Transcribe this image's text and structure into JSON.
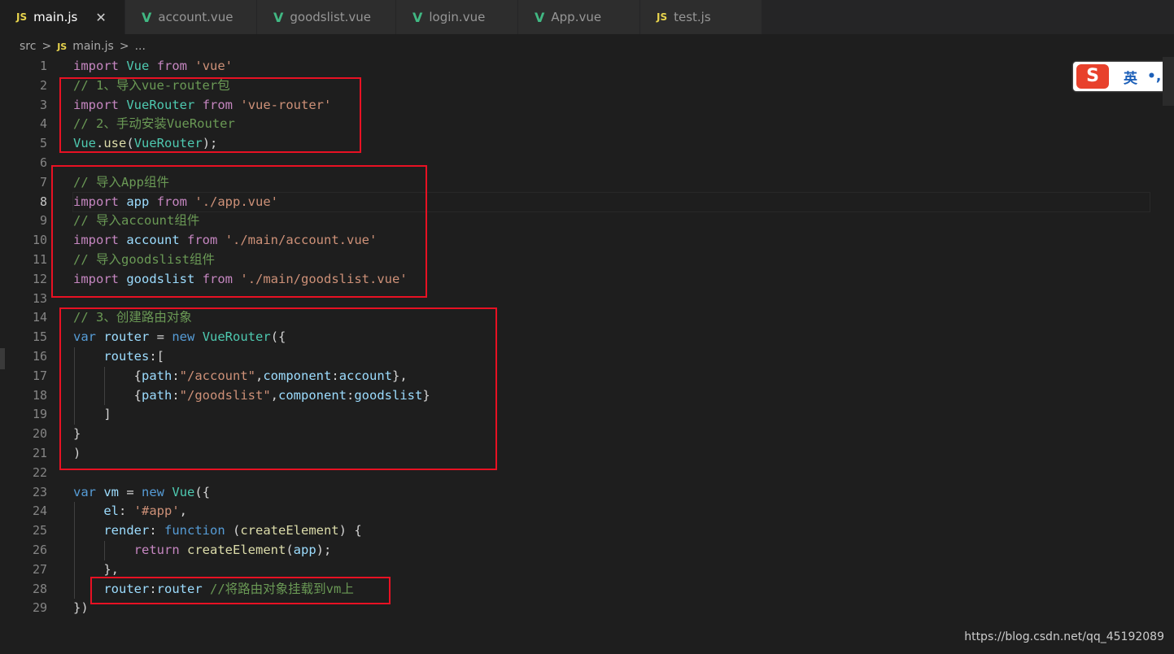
{
  "tabs": [
    {
      "label": "main.js",
      "icon": "JS",
      "type": "js",
      "active": true
    },
    {
      "label": "account.vue",
      "icon": "V",
      "type": "vue"
    },
    {
      "label": "goodslist.vue",
      "icon": "V",
      "type": "vue"
    },
    {
      "label": "login.vue",
      "icon": "V",
      "type": "vue"
    },
    {
      "label": "App.vue",
      "icon": "V",
      "type": "vue"
    },
    {
      "label": "test.js",
      "icon": "JS",
      "type": "js"
    }
  ],
  "close_glyph": "✕",
  "breadcrumb": {
    "folder": "src",
    "sep": ">",
    "file_icon": "JS",
    "file": "main.js",
    "more": "..."
  },
  "current_line": 8,
  "code_lines": [
    "import Vue from 'vue'",
    "// 1、导入vue-router包",
    "import VueRouter from 'vue-router'",
    "// 2、手动安装VueRouter",
    "Vue.use(VueRouter);",
    "",
    "// 导入App组件",
    "import app from './app.vue'",
    "// 导入account组件",
    "import account from './main/account.vue'",
    "// 导入goodslist组件",
    "import goodslist from './main/goodslist.vue'",
    "",
    "// 3、创建路由对象",
    "var router = new VueRouter({",
    "    routes:[",
    "        {path:\"/account\",component:account},",
    "        {path:\"/goodslist\",component:goodslist}",
    "    ]",
    "}",
    ")",
    "",
    "var vm = new Vue({",
    "    el: '#app',",
    "    render: function (createElement) {",
    "        return createElement(app);",
    "    },",
    "    router:router //将路由对象挂载到vm上",
    "})"
  ],
  "ime": {
    "logo": "S",
    "mode": "英",
    "punct": "•,"
  },
  "watermark": "https://blog.csdn.net/qq_45192089",
  "colors": {
    "keyword": "#c586c0",
    "string": "#ce9178",
    "comment": "#6a9955",
    "type": "#4ec9b0",
    "variable": "#9cdcfe",
    "function": "#dcdcaa",
    "storage": "#569cd6",
    "highlight_box": "#e81123"
  }
}
